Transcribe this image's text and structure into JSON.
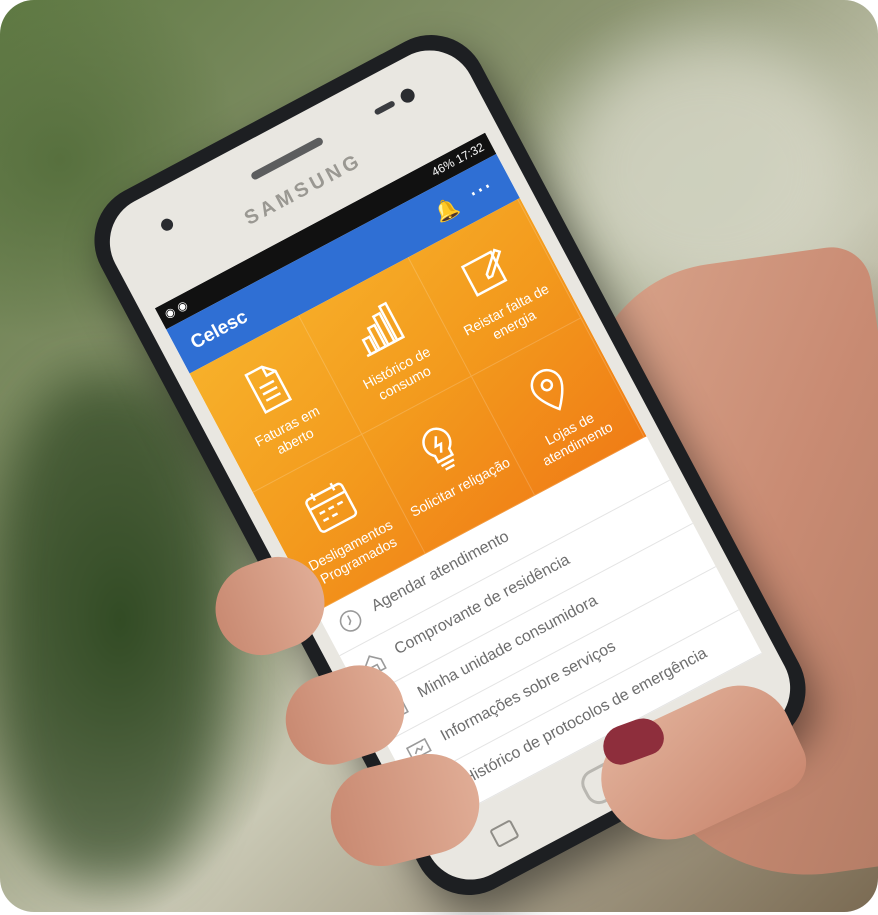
{
  "status_bar": {
    "left": "◉ ◉",
    "right": "46% 17:32"
  },
  "device": {
    "brand": "SAMSUNG"
  },
  "app": {
    "title": "Celesc"
  },
  "tiles": [
    {
      "label": "Faturas em aberto",
      "icon": "document-icon"
    },
    {
      "label": "Histórico de consumo",
      "icon": "bar-chart-icon"
    },
    {
      "label": "Reistar falta de energia",
      "icon": "edit-icon"
    },
    {
      "label": "Desligamentos Programados",
      "icon": "calendar-icon"
    },
    {
      "label": "Solicitar religação",
      "icon": "lightbulb-icon"
    },
    {
      "label": "Lojas de atendimento",
      "icon": "location-pin-icon"
    }
  ],
  "list": [
    {
      "label": "Agendar atendimento",
      "icon": "clock-icon"
    },
    {
      "label": "Comprovante de residência",
      "icon": "house-icon"
    },
    {
      "label": "Minha unidade consumidora",
      "icon": "list-icon"
    },
    {
      "label": "Informações sobre serviços",
      "icon": "monitor-icon"
    },
    {
      "label": "Histórico de protocolos de emergência",
      "icon": "clipboard-icon"
    }
  ],
  "colors": {
    "appbar": "#2f6fd4",
    "tiles": "#f39a1d",
    "nail": "#8e2e3c"
  }
}
